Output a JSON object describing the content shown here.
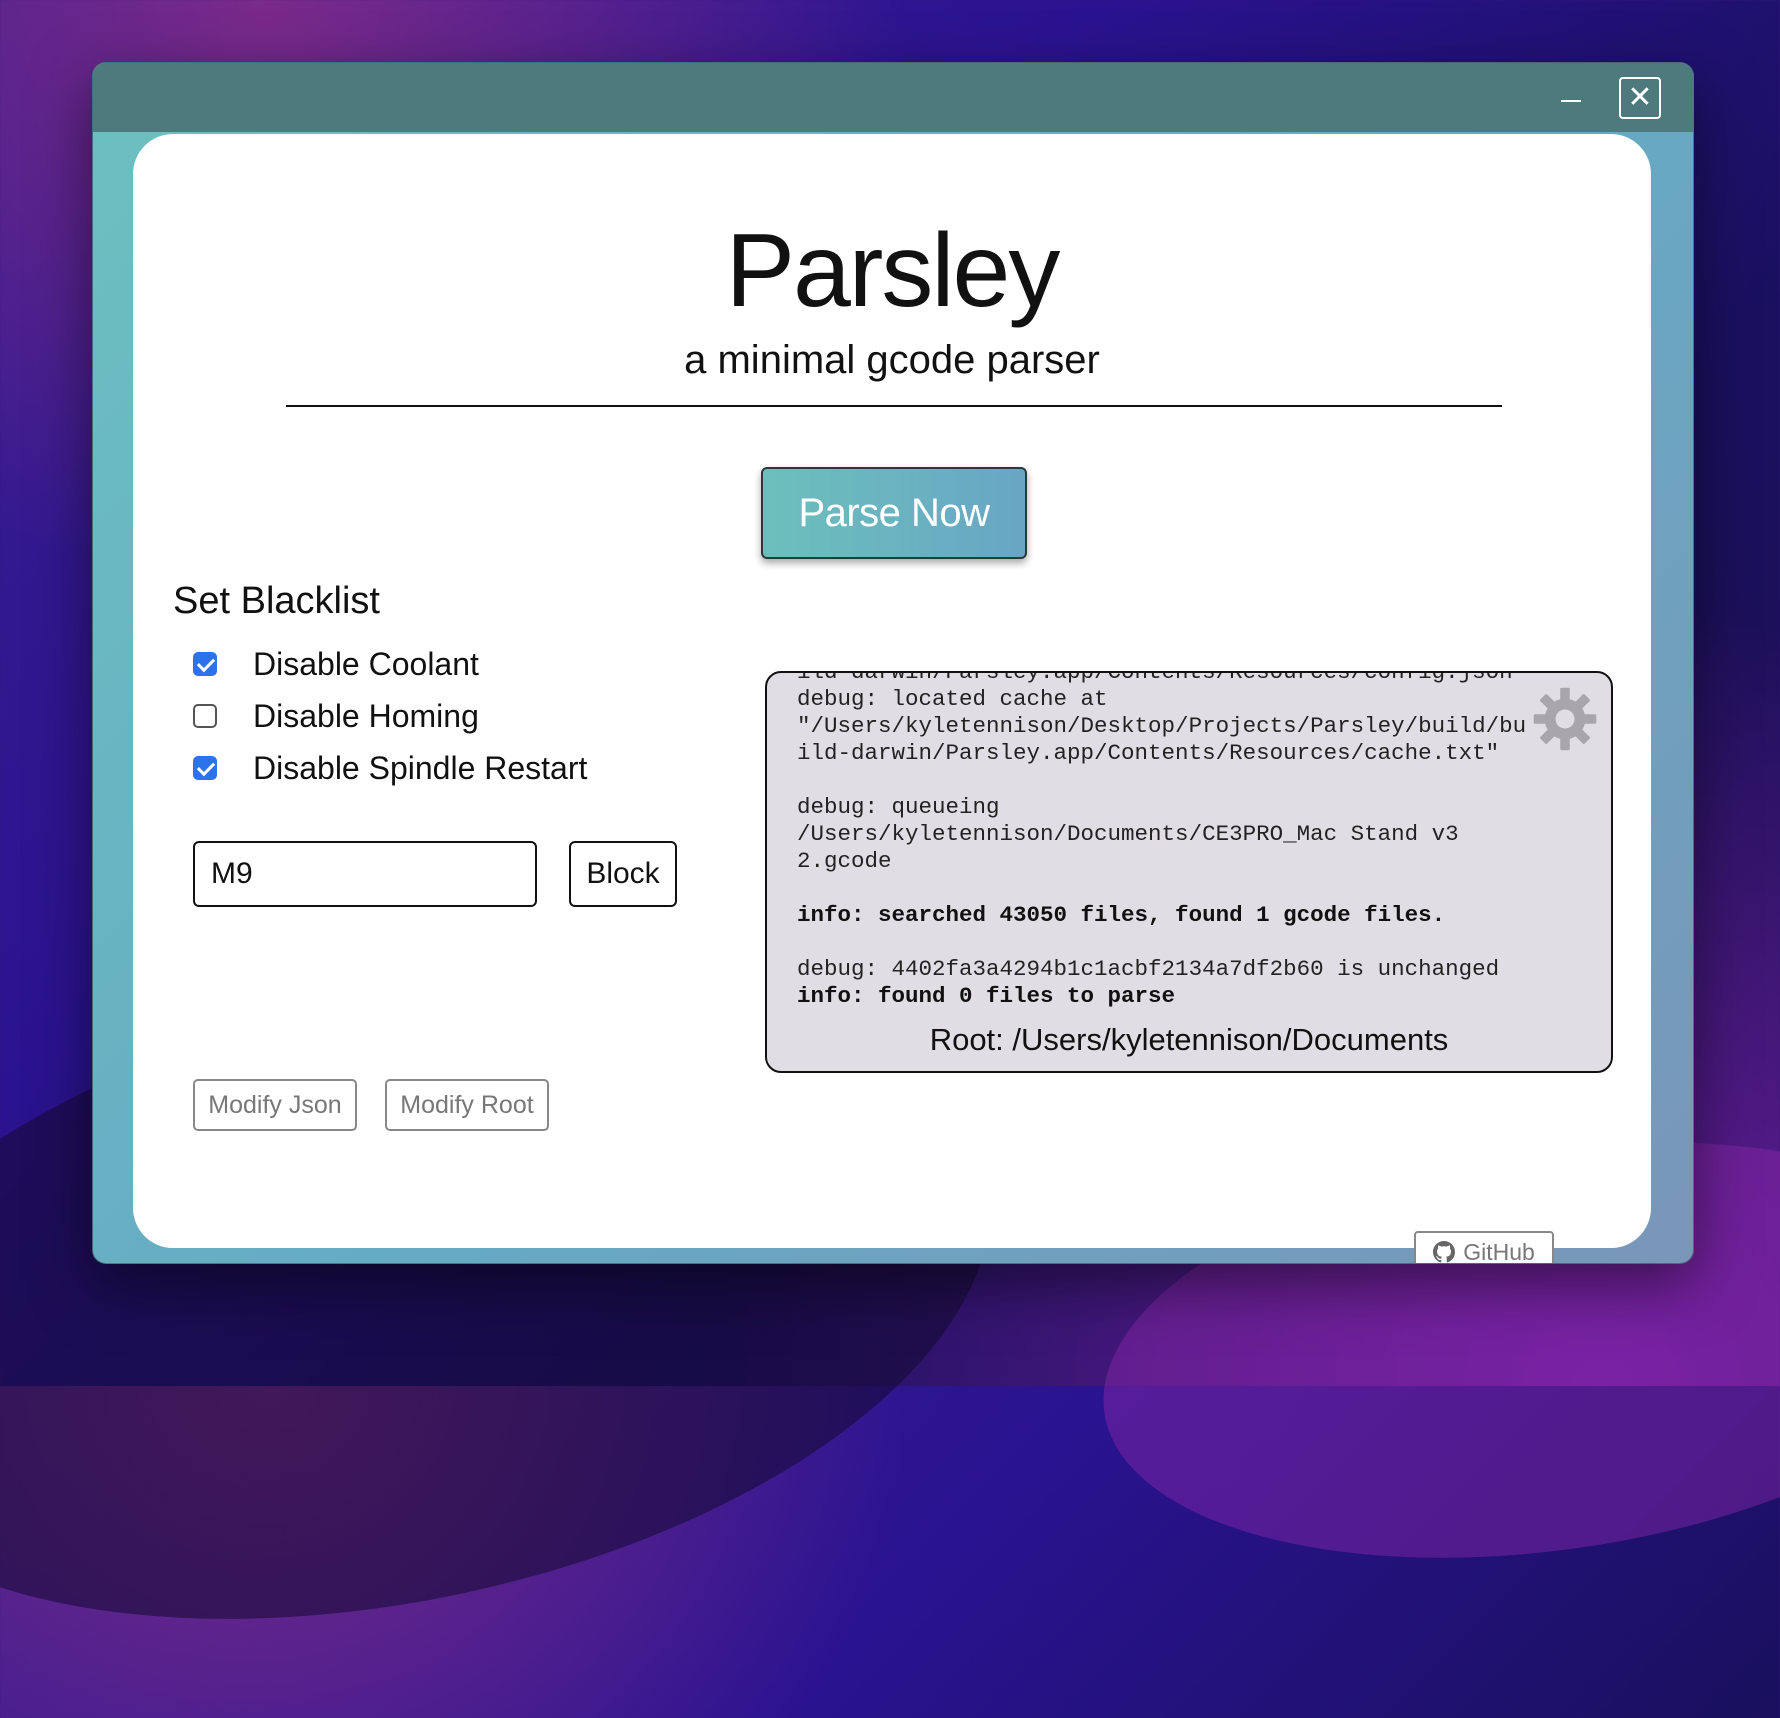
{
  "window": {
    "close_symbol": "✕"
  },
  "app": {
    "title": "Parsley",
    "subtitle": "a minimal gcode parser"
  },
  "parse_button": "Parse Now",
  "blacklist": {
    "heading": "Set Blacklist",
    "options": [
      {
        "label": "Disable Coolant",
        "checked": true
      },
      {
        "label": "Disable Homing",
        "checked": false
      },
      {
        "label": "Disable Spindle Restart",
        "checked": true
      }
    ],
    "input_value": "M9",
    "block_label": "Block"
  },
  "buttons": {
    "modify_json": "Modify Json",
    "modify_root": "Modify Root",
    "github": "GitHub"
  },
  "log": {
    "lines": [
      "ild-darwin/Parsley.app/Contents/Resources/config.json\"",
      "debug: located cache at",
      "\"/Users/kyletennison/Desktop/Projects/Parsley/build/bu",
      "ild-darwin/Parsley.app/Contents/Resources/cache.txt\"",
      "",
      "debug: queueing",
      "/Users/kyletennison/Documents/CE3PRO_Mac Stand v3",
      "2.gcode",
      "",
      "info: searched 43050 files, found 1 gcode files.",
      "",
      "debug: 4402fa3a4294b1c1acbf2134a7df2b60 is unchanged",
      "info: found 0 files to parse"
    ],
    "bold_lines": [
      9,
      12
    ]
  },
  "root_label": "Root: /Users/kyletennison/Documents",
  "icons": {
    "gear": "gear-icon",
    "github": "github-icon"
  }
}
